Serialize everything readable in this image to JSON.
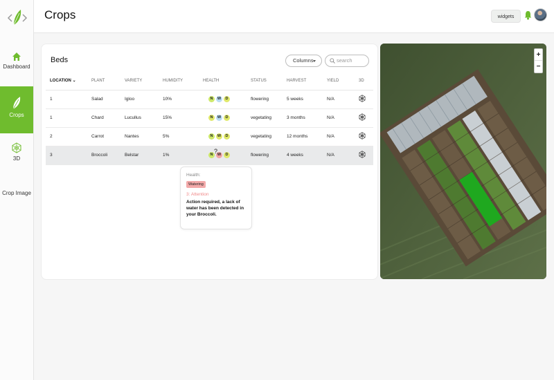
{
  "app": {
    "title": "Crops"
  },
  "sidebar": {
    "items": [
      {
        "label": "Dashboard",
        "icon": "home-icon"
      },
      {
        "label": "Crops",
        "icon": "leaf-icon"
      },
      {
        "label": "3D",
        "icon": "cube-icon"
      },
      {
        "label": "Crop Image"
      }
    ]
  },
  "header": {
    "widgets_label": "widgets"
  },
  "beds": {
    "title": "Beds",
    "columns_label": "Columns",
    "search_placeholder": "search",
    "headers": [
      "LOCATION",
      "PLANT",
      "VARIETY",
      "HUMIDITY",
      "HEALTH",
      "STATUS",
      "HARVEST",
      "YIELD",
      "3D"
    ],
    "rows": [
      {
        "location": "1",
        "plant": "Salad",
        "variety": "Igloo",
        "humidity": "10%",
        "status": "flowering",
        "harvest": "5 weeks",
        "yield": "N/A"
      },
      {
        "location": "1",
        "plant": "Chard",
        "variety": "Lucullus",
        "humidity": "15%",
        "status": "vegetating",
        "harvest": "3 months",
        "yield": "N/A"
      },
      {
        "location": "2",
        "plant": "Carrot",
        "variety": "Nantes",
        "humidity": "5%",
        "status": "vegetating",
        "harvest": "12 months",
        "yield": "N/A"
      },
      {
        "location": "3",
        "plant": "Broccoli",
        "variety": "Belstar",
        "humidity": "1%",
        "status": "flowering",
        "harvest": "4 weeks",
        "yield": "N/A"
      }
    ],
    "health_badges": {
      "n": "N",
      "w": "W",
      "d": "D"
    }
  },
  "tooltip": {
    "label": "Health:",
    "tag": "Watering",
    "status": "3: Attention",
    "message": "Action required, a lack of water has been detected in your Broccoli."
  },
  "map": {
    "zoom_in": "+",
    "zoom_out": "−"
  },
  "colors": {
    "accent": "#6fbc2e",
    "warning_red": "#f1a3a3",
    "badge_yellow": "#dfe86a",
    "badge_blue": "#b9dcf3"
  }
}
